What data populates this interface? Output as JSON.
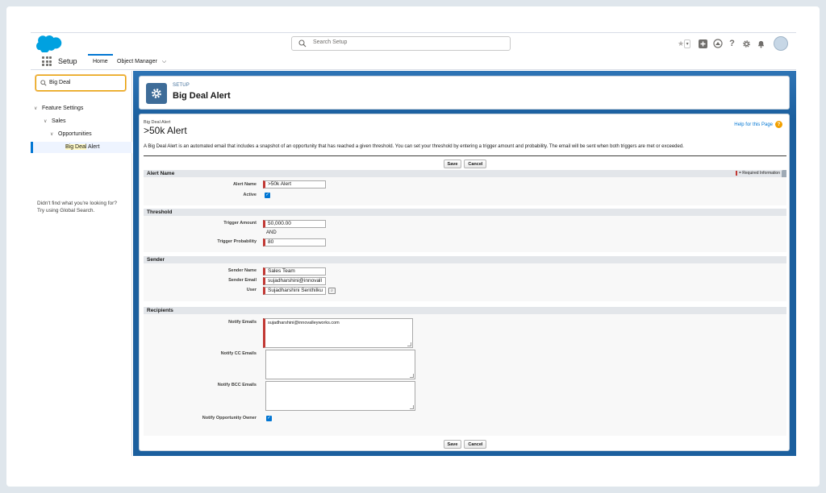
{
  "header": {
    "search_placeholder": "Search Setup",
    "app_name": "Setup"
  },
  "nav_tabs": {
    "home": "Home",
    "object_manager": "Object Manager"
  },
  "sidebar": {
    "quick_find_value": "Big Deal",
    "tree": {
      "feature_settings": "Feature Settings",
      "sales": "Sales",
      "opportunities": "Opportunities",
      "selected_prefix": "Big Deal",
      "selected_suffix": " Alert"
    },
    "help_note_line1": "Didn't find what you're looking for?",
    "help_note_line2": "Try using Global Search."
  },
  "page_header": {
    "breadcrumb": "SETUP",
    "title": "Big Deal Alert"
  },
  "detail": {
    "subtitle": "Big Deal Alert",
    "title": ">50k Alert",
    "help_link": "Help for this Page",
    "description": "A Big Deal Alert is an automated email that includes a snapshot of an opportunity that has reached a given threshold. You can set your threshold by entering a trigger amount and probability. The email will be sent when both triggers are met or exceeded.",
    "save_label": "Save",
    "cancel_label": "Cancel",
    "required_info": "= Required Information"
  },
  "sections": {
    "alert_name": {
      "heading": "Alert Name",
      "alert_name_label": "Alert Name",
      "alert_name_value": ">50k Alert",
      "active_label": "Active",
      "active_checked": true
    },
    "threshold": {
      "heading": "Threshold",
      "trigger_amount_label": "Trigger Amount",
      "trigger_amount_value": "50,000.00",
      "and_text": "AND",
      "trigger_probability_label": "Trigger Probability",
      "trigger_probability_value": "80"
    },
    "sender": {
      "heading": "Sender",
      "sender_name_label": "Sender Name",
      "sender_name_value": "Sales Team",
      "sender_email_label": "Sender Email",
      "sender_email_value": "sujadharshini@innovall",
      "user_label": "User",
      "user_value": "Sujadharshini Senthilku"
    },
    "recipients": {
      "heading": "Recipients",
      "notify_emails_label": "Notify Emails",
      "notify_emails_value": "sujadharshini@innovalleyworks.com",
      "notify_cc_label": "Notify CC Emails",
      "notify_cc_value": "",
      "notify_bcc_label": "Notify BCC Emails",
      "notify_bcc_value": "",
      "notify_owner_label": "Notify Opportunity Owner",
      "notify_owner_checked": true
    }
  },
  "colors": {
    "brand_blue": "#0176d3",
    "required_red": "#c23934",
    "banner_blue": "#1b5f9e",
    "quickfind_highlight": "#e8a200"
  },
  "icons": {
    "logo": "salesforce-cloud-logo",
    "search": "search-icon",
    "favorites": "star-icon",
    "add": "plus-icon",
    "trailhead": "trailhead-icon",
    "help": "question-icon",
    "settings": "gear-icon",
    "notifications": "bell-icon",
    "user": "avatar"
  }
}
